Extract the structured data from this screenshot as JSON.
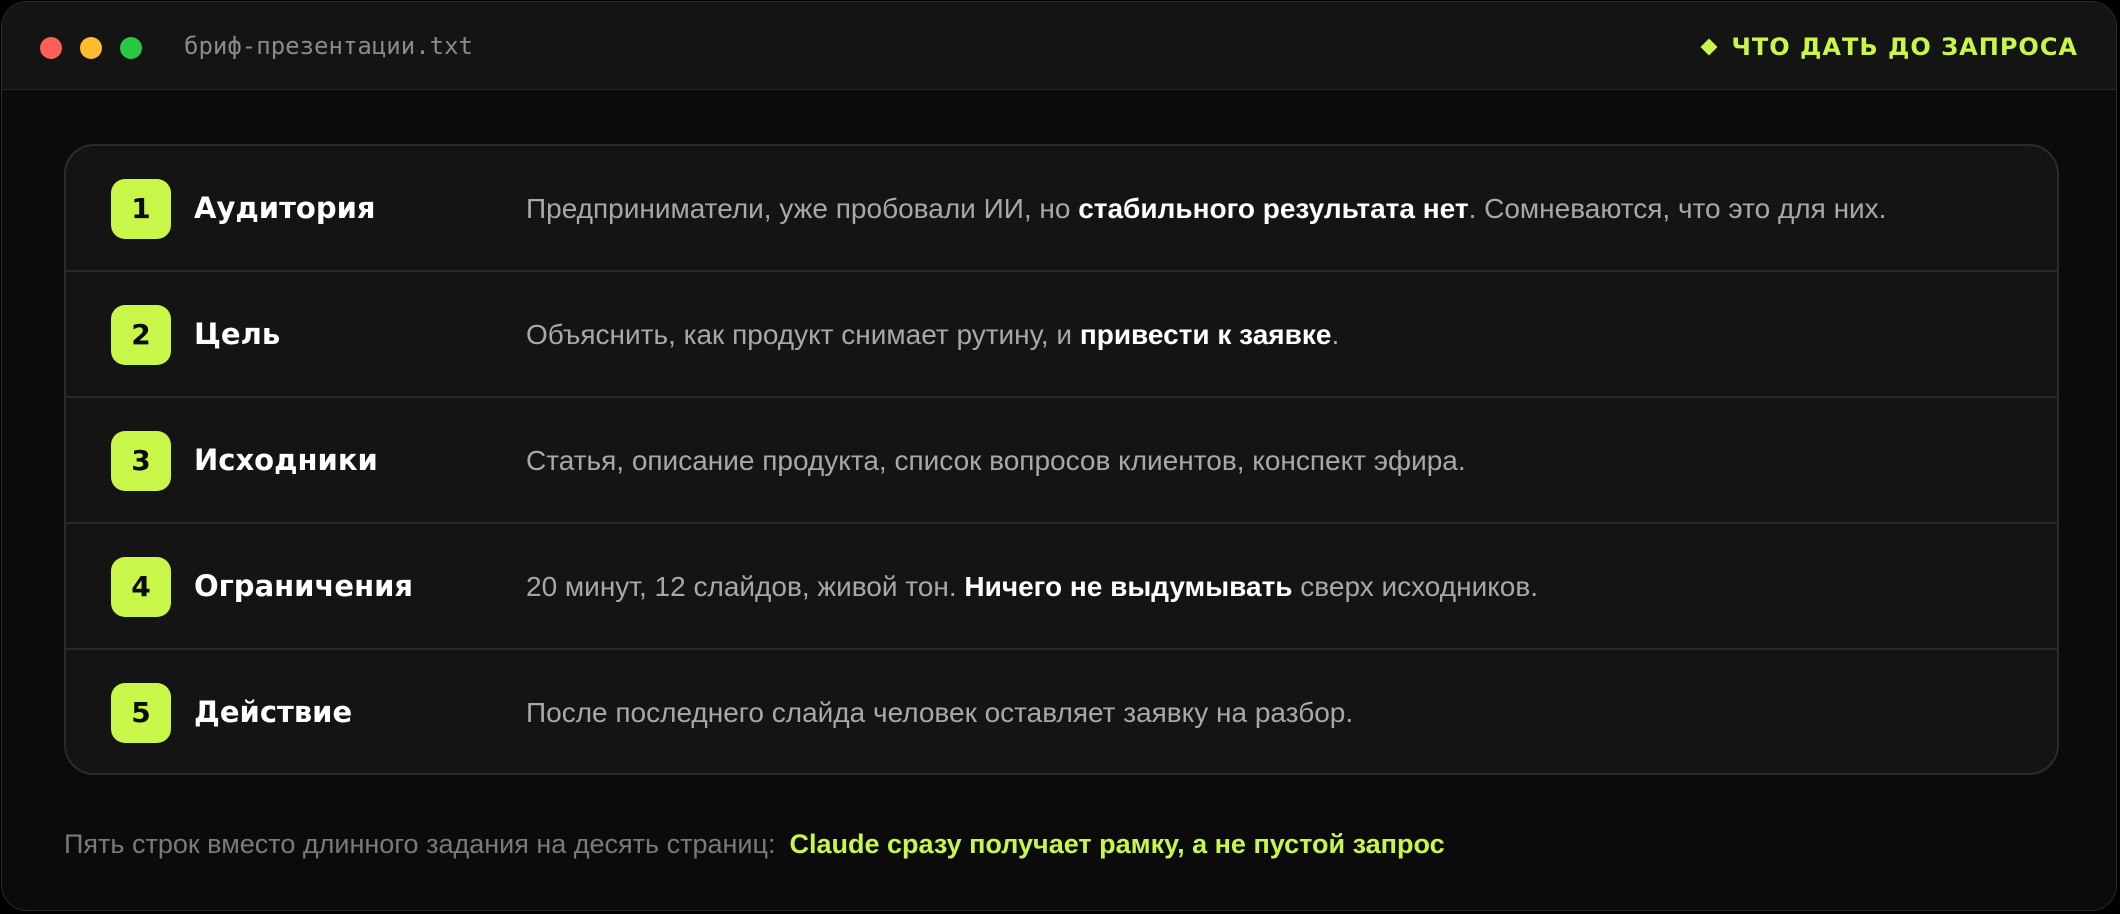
{
  "window": {
    "filename": "бриф-презентации.txt",
    "header_right": "ЧТО ДАТЬ ДО ЗАПРОСА",
    "accent_color": "#c8f74a"
  },
  "rows": [
    {
      "number": "1",
      "label": "Аудитория",
      "desc_before": "Предприниматели, уже пробовали ИИ, но ",
      "desc_bold": "стабильного результата нет",
      "desc_after": ". Сомневаются, что это для них."
    },
    {
      "number": "2",
      "label": "Цель",
      "desc_before": "Объяснить, как продукт снимает рутину, и ",
      "desc_bold": "привести к заявке",
      "desc_after": "."
    },
    {
      "number": "3",
      "label": "Исходники",
      "desc_before": "Статья, описание продукта, список вопросов клиентов, конспект эфира.",
      "desc_bold": "",
      "desc_after": ""
    },
    {
      "number": "4",
      "label": "Ограничения",
      "desc_before": "20 минут, 12 слайдов, живой тон. ",
      "desc_bold": "Ничего не выдумывать",
      "desc_after": " сверх исходников."
    },
    {
      "number": "5",
      "label": "Действие",
      "desc_before": "После последнего слайда человек оставляет заявку на разбор.",
      "desc_bold": "",
      "desc_after": ""
    }
  ],
  "footer": {
    "muted": "Пять строк вместо длинного задания на десять страниц:",
    "accent": "Claude сразу получает рамку, а не пустой запрос"
  }
}
